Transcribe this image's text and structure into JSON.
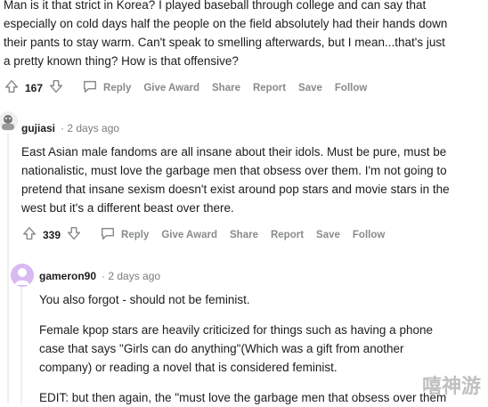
{
  "top_comment": {
    "lines": [
      "Man is it that strict in Korea? I played baseball through college and can say that",
      "especially on cold days half the people on the field absolutely had their hands down",
      "their pants to stay warm. Can't speak to smelling afterwards, but I mean...that's just",
      "a pretty known thing? How is that offensive?"
    ],
    "votes": "167"
  },
  "actions": {
    "reply": "Reply",
    "give_award": "Give Award",
    "share": "Share",
    "report": "Report",
    "save": "Save",
    "follow": "Follow"
  },
  "comment2": {
    "username": "gujiasi",
    "time": "· 2 days ago",
    "lines": [
      "East Asian male fandoms are all insane about their idols. Must be pure, must be",
      "nationalistic, must love the garbage men that obsess over them. I'm not going to",
      "pretend that insane sexism doesn't exist around pop stars and movie stars in the",
      "west but it's a different beast over there."
    ],
    "votes": "339"
  },
  "comment3": {
    "username": "gameron90",
    "time": "· 2 days ago",
    "para1": "You also forgot - should not be feminist.",
    "para2_lines": [
      "Female kpop stars are heavily criticized for things such as having a phone",
      "case that says \"Girls can do anything\"(Which was a gift from another",
      "company) or reading a novel that is considered feminist."
    ],
    "para3": "EDIT: but then again, the \"must love the garbage men that obsess over them"
  },
  "watermark": "嘻神游"
}
